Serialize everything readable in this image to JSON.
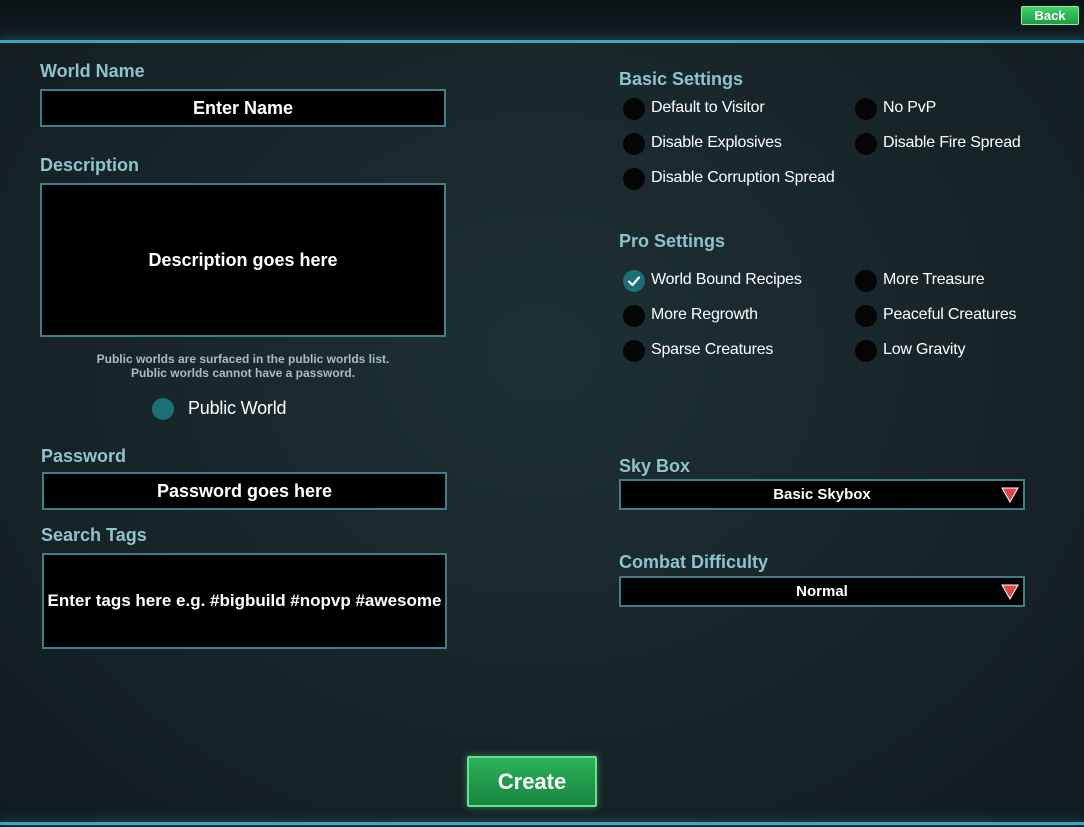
{
  "header": {
    "back_label": "Back"
  },
  "world_name": {
    "label": "World Name",
    "placeholder": "Enter Name"
  },
  "description": {
    "label": "Description",
    "placeholder": "Description goes here"
  },
  "public_note": {
    "line1": "Public worlds are surfaced in the public worlds list.",
    "line2": "Public worlds cannot have a password."
  },
  "public_world": {
    "label": "Public World",
    "checked": true
  },
  "password": {
    "label": "Password",
    "placeholder": "Password goes here"
  },
  "search_tags": {
    "label": "Search Tags",
    "placeholder": "Enter tags here e.g. #bigbuild #nopvp #awesome"
  },
  "basic_settings": {
    "title": "Basic Settings",
    "options": [
      {
        "label": "Default to Visitor",
        "checked": false
      },
      {
        "label": "No PvP",
        "checked": false
      },
      {
        "label": "Disable Explosives",
        "checked": false
      },
      {
        "label": "Disable Fire Spread",
        "checked": false
      },
      {
        "label": "Disable Corruption Spread",
        "checked": false
      }
    ]
  },
  "pro_settings": {
    "title": "Pro Settings",
    "options": [
      {
        "label": "World Bound Recipes",
        "checked": true
      },
      {
        "label": "More Treasure",
        "checked": false
      },
      {
        "label": "More Regrowth",
        "checked": false
      },
      {
        "label": "Peaceful Creatures",
        "checked": false
      },
      {
        "label": "Sparse Creatures",
        "checked": false
      },
      {
        "label": "Low Gravity",
        "checked": false
      }
    ]
  },
  "sky_box": {
    "label": "Sky Box",
    "value": "Basic Skybox"
  },
  "combat_difficulty": {
    "label": "Combat Difficulty",
    "value": "Normal"
  },
  "create_label": "Create",
  "colors": {
    "accent": "#3aa6bf",
    "button_green": "#2bb25a",
    "caret_red": "#e04848",
    "label_color": "#8fc3cc"
  }
}
